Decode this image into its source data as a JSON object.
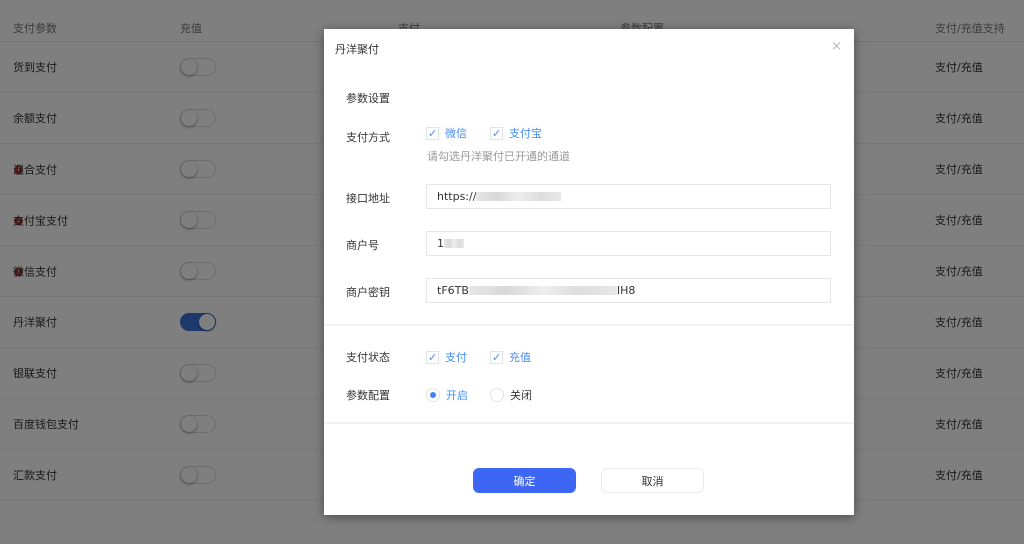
{
  "table": {
    "headers": [
      "支付参数",
      "充值",
      "支付",
      "参数配置",
      "支付/充值支持"
    ],
    "rows": [
      {
        "name": "货到支付",
        "info": false,
        "enabled": false,
        "support": "支付/充值"
      },
      {
        "name": "余额支付",
        "info": false,
        "enabled": false,
        "support": "支付/充值"
      },
      {
        "name": "混合支付",
        "info": true,
        "enabled": false,
        "support": "支付/充值"
      },
      {
        "name": "支付宝支付",
        "info": true,
        "enabled": false,
        "support": "支付/充值"
      },
      {
        "name": "微信支付",
        "info": true,
        "enabled": false,
        "support": "支付/充值"
      },
      {
        "name": "丹洋聚付",
        "info": false,
        "enabled": true,
        "support": "支付/充值"
      },
      {
        "name": "银联支付",
        "info": false,
        "enabled": false,
        "support": "支付/充值"
      },
      {
        "name": "百度钱包支付",
        "info": false,
        "enabled": false,
        "support": "支付/充值"
      },
      {
        "name": "汇款支付",
        "info": false,
        "enabled": false,
        "support": "支付/充值"
      }
    ]
  },
  "modal": {
    "title": "丹洋聚付",
    "close": "×",
    "section": "参数设置",
    "pay_method": {
      "label": "支付方式",
      "options": [
        {
          "label": "微信",
          "checked": true
        },
        {
          "label": "支付宝",
          "checked": true
        }
      ],
      "hint": "请勾选丹洋聚付已开通的通道"
    },
    "api_url": {
      "label": "接口地址",
      "value_prefix": "https://"
    },
    "merchant_id": {
      "label": "商户号",
      "value_prefix": "1"
    },
    "merchant_key": {
      "label": "商户密钥",
      "value_prefix": "tF6TB",
      "value_suffix": "IH8"
    },
    "pay_status": {
      "label": "支付状态",
      "options": [
        {
          "label": "支付",
          "checked": true
        },
        {
          "label": "充值",
          "checked": true
        }
      ]
    },
    "param_config": {
      "label": "参数配置",
      "options": [
        {
          "label": "开启",
          "selected": true
        },
        {
          "label": "关闭",
          "selected": false
        }
      ]
    },
    "ok": "确定",
    "cancel": "取消",
    "accent": "#3e66f5"
  }
}
